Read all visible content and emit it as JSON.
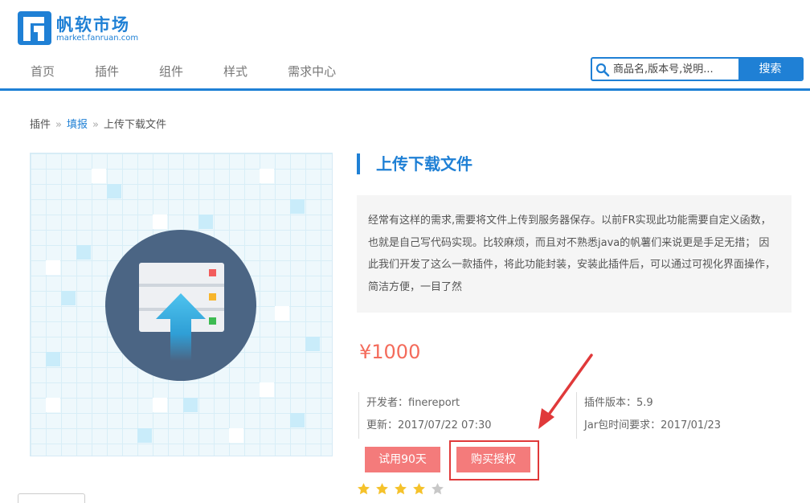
{
  "brand": {
    "title": "帆软市场",
    "subtitle": "market.fanruan.com",
    "color": "#1f80d5"
  },
  "nav": {
    "items": [
      {
        "label": "首页"
      },
      {
        "label": "插件"
      },
      {
        "label": "组件"
      },
      {
        "label": "样式"
      },
      {
        "label": "需求中心"
      }
    ]
  },
  "search": {
    "placeholder": "商品名,版本号,说明...",
    "button_label": "搜索"
  },
  "breadcrumb": {
    "items": [
      "插件",
      "填报",
      "上传下载文件"
    ],
    "separator": "»"
  },
  "product": {
    "title": "上传下载文件",
    "description": "经常有这样的需求,需要将文件上传到服务器保存。以前FR实现此功能需要自定义函数，也就是自己写代码实现。比较麻烦，而且对不熟悉java的帆薯们来说更是手足无措； 因此我们开发了这么一款插件，将此功能封装，安装此插件后，可以通过可视化界面操作，简洁方便，一目了然",
    "price": "¥1000",
    "developer": "开发者：finereport",
    "updated": "更新：2017/07/22 07:30",
    "version": "插件版本：5.9",
    "jar_requirement": "Jar包时间要求：2017/01/23",
    "rating": 4,
    "rating_max": 5,
    "preview_icon": "upload-server-icon"
  },
  "buttons": {
    "trial_label": "试用90天",
    "buy_label": "购买授权"
  },
  "colors": {
    "accent": "#1f80d5",
    "price": "#f46b5b",
    "button": "#f47b7b",
    "highlight": "#e0393a",
    "star": "#f5c22b"
  }
}
